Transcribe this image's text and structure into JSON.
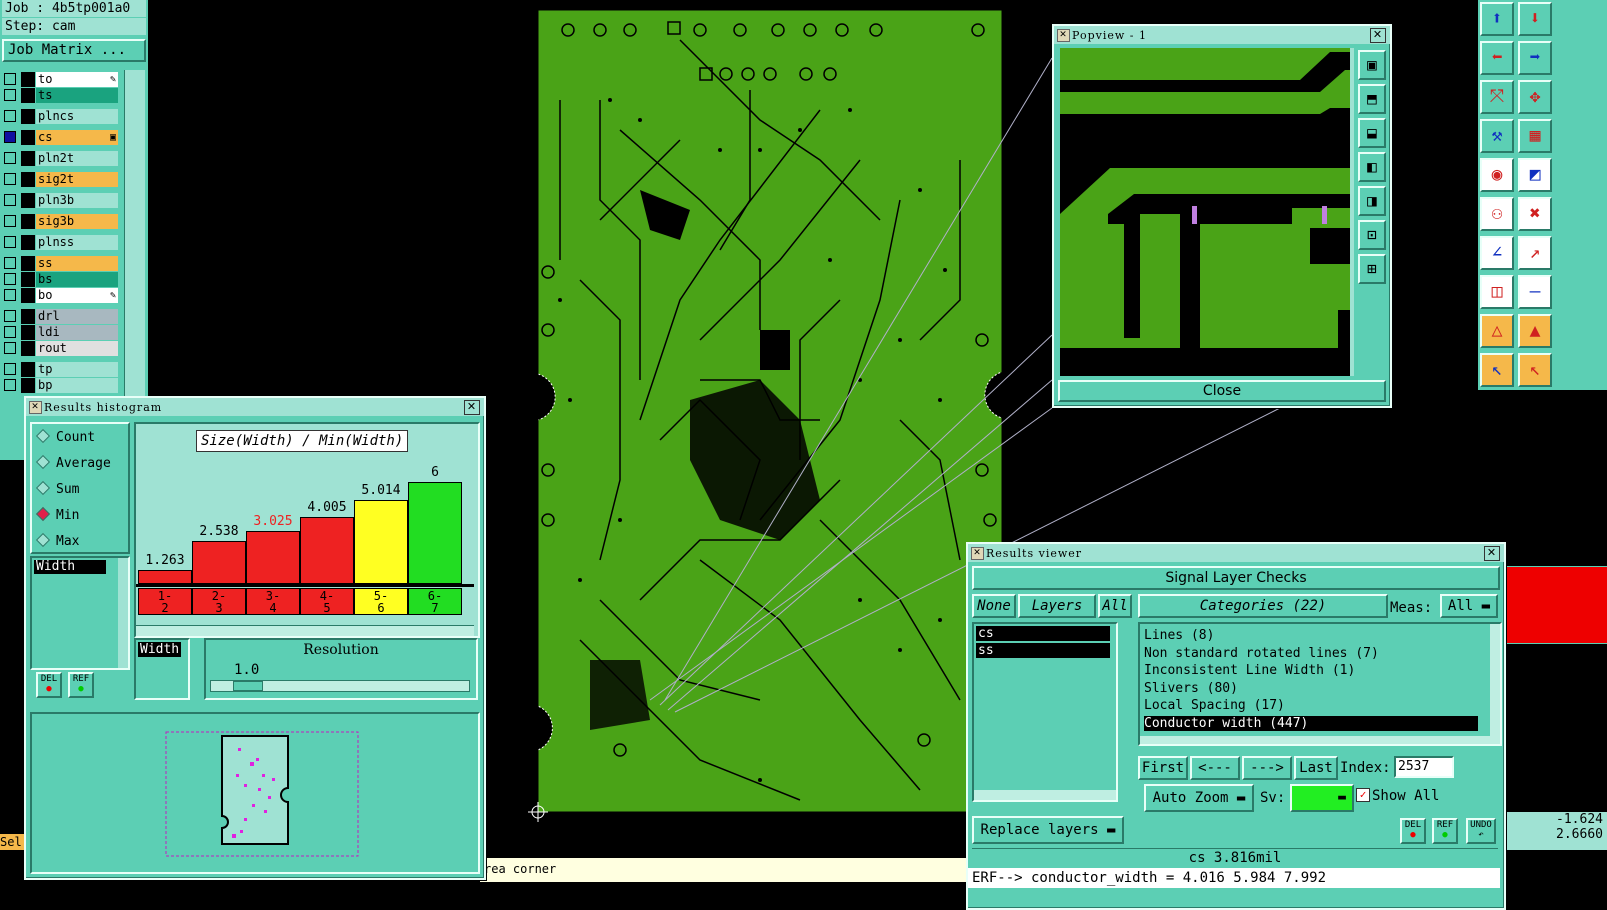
{
  "job": {
    "job_label": "Job : 4b5tp001a0",
    "step_label": "Step: cam",
    "matrix_button": "Job Matrix ..."
  },
  "layers": [
    {
      "name": "to",
      "color": "#ffffff",
      "edit": "✎"
    },
    {
      "name": "ts",
      "color": "#1aa37f",
      "edit": ""
    },
    {
      "name": "plncs",
      "color": "#9fe2d3",
      "edit": ""
    },
    {
      "name": "cs",
      "color": "#f5b84a",
      "edit": "▣"
    },
    {
      "name": "pln2t",
      "color": "#9fe2d3",
      "edit": ""
    },
    {
      "name": "sig2t",
      "color": "#f5b84a",
      "edit": ""
    },
    {
      "name": "pln3b",
      "color": "#9fe2d3",
      "edit": ""
    },
    {
      "name": "sig3b",
      "color": "#f5b84a",
      "edit": ""
    },
    {
      "name": "plnss",
      "color": "#9fe2d3",
      "edit": ""
    },
    {
      "name": "ss",
      "color": "#f5b84a",
      "edit": ""
    },
    {
      "name": "bs",
      "color": "#1aa37f",
      "edit": ""
    },
    {
      "name": "bo",
      "color": "#ffffff",
      "edit": "✎"
    },
    {
      "name": "drl",
      "color": "#a8b8c0",
      "edit": ""
    },
    {
      "name": "ldi",
      "color": "#a8b8c0",
      "edit": ""
    },
    {
      "name": "rout",
      "color": "#e0e0e0",
      "edit": ""
    },
    {
      "name": "tp",
      "color": "#9fe2d3",
      "edit": ""
    },
    {
      "name": "bp",
      "color": "#9fe2d3",
      "edit": ""
    }
  ],
  "histogram": {
    "title": "Results histogram",
    "options": [
      "Count",
      "Average",
      "Sum",
      "Min",
      "Max"
    ],
    "selected_option": "Min",
    "chart_title": "Size(Width) / Min(Width)",
    "list_item": "Width",
    "bars": [
      {
        "bin": "1-2",
        "value": "1.263",
        "color": "#ee2222",
        "level": 0.14,
        "label_color": "#000"
      },
      {
        "bin": "2-3",
        "value": "2.538",
        "color": "#ee2222",
        "level": 0.42,
        "label_color": "#000"
      },
      {
        "bin": "3-4",
        "value": "3.025",
        "color": "#ee2222",
        "level": 0.52,
        "label_color": "#ee2222"
      },
      {
        "bin": "4-5",
        "value": "4.005",
        "color": "#ee2222",
        "level": 0.66,
        "label_color": "#000"
      },
      {
        "bin": "5-6",
        "value": "5.014",
        "color": "#ffff22",
        "level": 0.82,
        "label_color": "#000"
      },
      {
        "bin": "6-7",
        "value": "6",
        "color": "#22dd22",
        "level": 1.0,
        "label_color": "#000"
      }
    ],
    "field": "Width",
    "resolution_label": "Resolution",
    "resolution_value": "1.0",
    "del": "DEL",
    "ref": "REF"
  },
  "popview": {
    "title": "Popview - 1",
    "close": "Close"
  },
  "viewer": {
    "title": "Results viewer",
    "header": "Signal Layer Checks",
    "none": "None",
    "layers": "Layers",
    "all": "All",
    "categories_label": "Categories (22)",
    "meas_label": "Meas:",
    "meas_value": "All",
    "layer_items": [
      "cs",
      "ss"
    ],
    "categories": [
      "Lines (8)",
      "Non standard rotated lines (7)",
      "Inconsistent Line Width (1)",
      "Slivers (80)",
      "Local Spacing (17)",
      "Conductor width (447)"
    ],
    "selected_category": "Conductor width (447)",
    "first": "First",
    "prev": "<---",
    "next": "--->",
    "last": "Last",
    "index_label": "Index:",
    "index_value": "2537",
    "auto_zoom": "Auto Zoom",
    "sv_label": "Sv:",
    "show_all": "Show All",
    "replace_layers": "Replace layers",
    "del": "DEL",
    "ref": "REF",
    "undo": "UNDO",
    "status": "cs 3.816mil",
    "erf": "ERF--> conductor_width = 4.016 5.984 7.992"
  },
  "status_bar": {
    "text": "rea corner",
    "sel": "Sel"
  },
  "coords": {
    "x": "-1.624",
    "y": "2.6660"
  }
}
